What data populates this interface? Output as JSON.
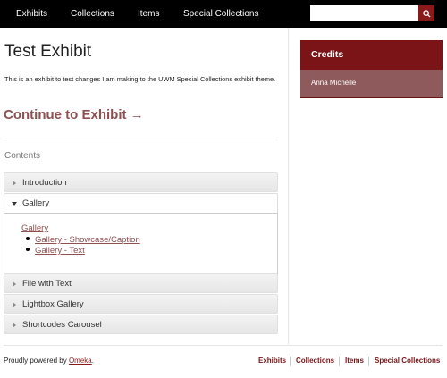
{
  "nav": {
    "items": [
      "Exhibits",
      "Collections",
      "Items",
      "Special Collections"
    ],
    "search": {
      "value": "",
      "placeholder": ""
    },
    "search_icon": "search-icon"
  },
  "main": {
    "title": "Test Exhibit",
    "description": "This is an exhibit to test changes I am making to the UWM Special Collections exhibit theme.",
    "continue_label": "Continue to Exhibit →",
    "contents_heading": "Contents",
    "accordion": [
      {
        "label": "Introduction",
        "expanded": false
      },
      {
        "label": "Gallery",
        "expanded": true
      },
      {
        "label": "File with Text",
        "expanded": false
      },
      {
        "label": "Lightbox Gallery",
        "expanded": false
      },
      {
        "label": "Shortcodes Carousel",
        "expanded": false
      }
    ],
    "gallery_body": {
      "link": "Gallery",
      "children": [
        "Gallery - Showcase/Caption",
        "Gallery - Text"
      ]
    }
  },
  "sidebar": {
    "credits_title": "Credits",
    "credits_name": "Anna Michelle"
  },
  "footer": {
    "powered_prefix": "Proudly powered by ",
    "powered_link": "Omeka",
    "powered_suffix": ".",
    "nav": [
      "Exhibits",
      "Collections",
      "Items",
      "Special Collections"
    ]
  },
  "colors": {
    "nav_bg": "#000000",
    "accent": "#7a1417",
    "link": "#8f5050",
    "credits_body": "#8f5a5c"
  }
}
